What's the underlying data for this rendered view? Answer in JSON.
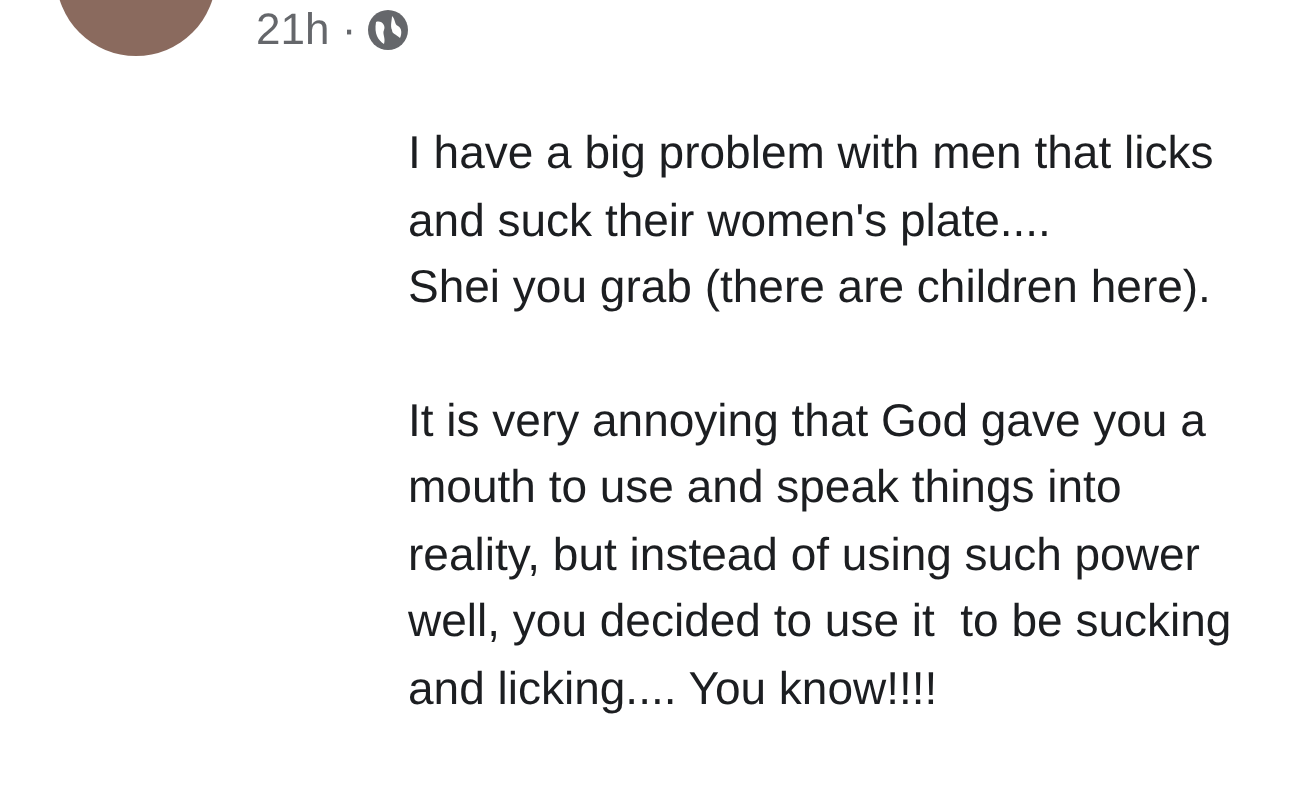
{
  "post": {
    "time": "21h ·",
    "paragraphs": [
      "I have a big problem with men that licks\nand suck their women's plate....\nShei you grab (there are children here).",
      "It is very annoying that God gave you a\nmouth to use and speak things into\nreality, but instead of using such power\nwell, you decided to use it  to be sucking\nand licking.... You know!!!!"
    ]
  }
}
